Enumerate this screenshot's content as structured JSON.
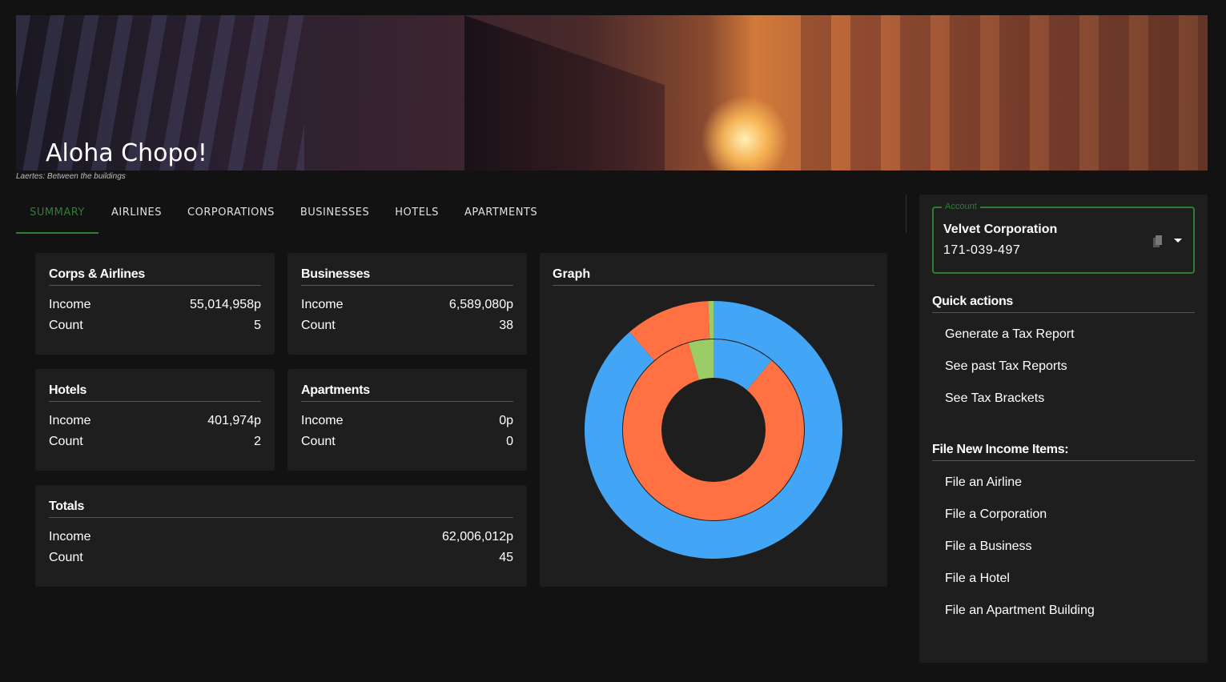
{
  "banner": {
    "greeting": "Aloha Chopo!",
    "caption": "Laertes: Between the buildings"
  },
  "tabs": [
    {
      "label": "SUMMARY",
      "active": true
    },
    {
      "label": "AIRLINES",
      "active": false
    },
    {
      "label": "CORPORATIONS",
      "active": false
    },
    {
      "label": "BUSINESSES",
      "active": false
    },
    {
      "label": "HOTELS",
      "active": false
    },
    {
      "label": "APARTMENTS",
      "active": false
    }
  ],
  "cards": {
    "corps": {
      "title": "Corps & Airlines",
      "income_label": "Income",
      "income": "55,014,958p",
      "count_label": "Count",
      "count": "5"
    },
    "businesses": {
      "title": "Businesses",
      "income_label": "Income",
      "income": "6,589,080p",
      "count_label": "Count",
      "count": "38"
    },
    "hotels": {
      "title": "Hotels",
      "income_label": "Income",
      "income": "401,974p",
      "count_label": "Count",
      "count": "2"
    },
    "apartments": {
      "title": "Apartments",
      "income_label": "Income",
      "income": "0p",
      "count_label": "Count",
      "count": "0"
    },
    "totals": {
      "title": "Totals",
      "income_label": "Income",
      "income": "62,006,012p",
      "count_label": "Count",
      "count": "45"
    }
  },
  "graph": {
    "title": "Graph"
  },
  "chart_data": {
    "type": "pie",
    "style": "nested-donut",
    "title": "Graph",
    "rings": [
      {
        "name": "Income",
        "categories": [
          "Corps & Airlines",
          "Businesses",
          "Hotels",
          "Apartments"
        ],
        "values": [
          55014958,
          6589080,
          401974,
          0
        ],
        "colors": [
          "#42a5f5",
          "#ff7043",
          "#9ccc65",
          "#ffca28"
        ]
      },
      {
        "name": "Count",
        "categories": [
          "Corps & Airlines",
          "Businesses",
          "Hotels",
          "Apartments"
        ],
        "values": [
          5,
          38,
          2,
          0
        ],
        "colors": [
          "#42a5f5",
          "#ff7043",
          "#9ccc65",
          "#ffca28"
        ]
      }
    ]
  },
  "account": {
    "legend": "Account",
    "name": "Velvet Corporation",
    "id": "171-039-497",
    "icons": [
      "copy-icon",
      "caret-down-icon"
    ]
  },
  "quick_actions": {
    "title": "Quick actions",
    "items": [
      "Generate a Tax Report",
      "See past Tax Reports",
      "See Tax Brackets"
    ]
  },
  "file_new": {
    "title": "File New Income Items:",
    "items": [
      "File an Airline",
      "File a Corporation",
      "File a Business",
      "File a Hotel",
      "File an Apartment Building"
    ]
  },
  "colors": {
    "accent": "#2e7d32",
    "background": "#121212",
    "card": "#1e1e1e"
  }
}
